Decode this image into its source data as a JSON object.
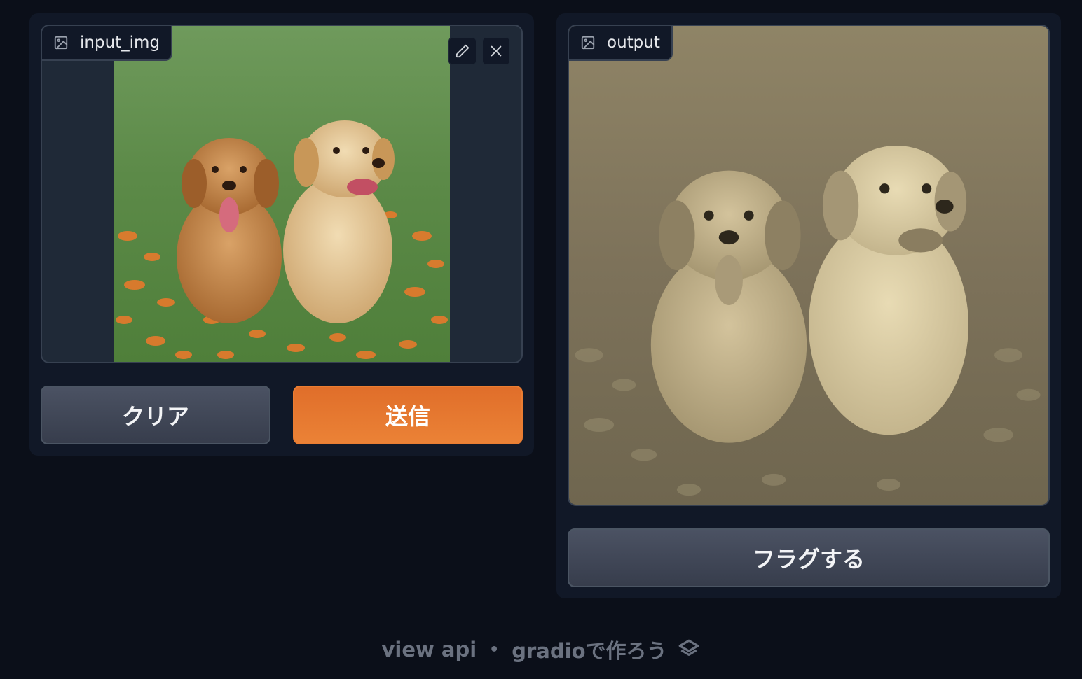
{
  "input_panel": {
    "label": "input_img",
    "icons": [
      "image-icon",
      "edit-icon",
      "close-icon"
    ],
    "image_alt": "two golden retriever puppies sitting on grass with orange flowers"
  },
  "output_panel": {
    "label": "output",
    "icons": [
      "image-icon"
    ],
    "image_alt": "sepia-toned version of the two puppies"
  },
  "buttons": {
    "clear": "クリア",
    "submit": "送信",
    "flag": "フラグする"
  },
  "footer": {
    "view_api": "view api",
    "separator": "•",
    "built_with": "gradioで作ろう"
  },
  "colors": {
    "background": "#0b0f19",
    "panel": "#111827",
    "primary": "#ea7d32",
    "secondary": "#4b5263"
  }
}
